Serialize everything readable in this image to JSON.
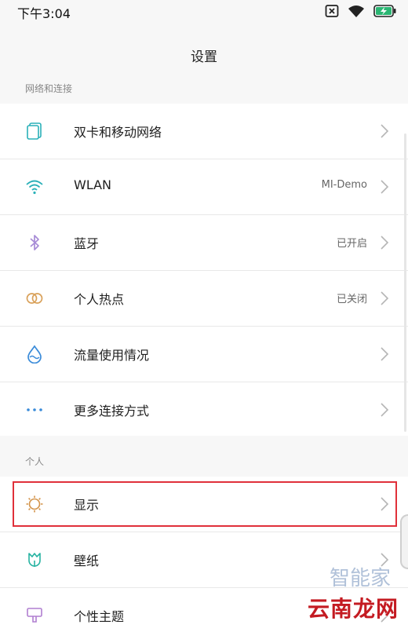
{
  "status_bar": {
    "time": "下午3:04",
    "icons": [
      "sim-none-icon",
      "wifi-icon",
      "battery-charging-icon"
    ]
  },
  "header": {
    "title": "设置"
  },
  "sections": {
    "network": {
      "title": "网络和连接",
      "items": [
        {
          "label": "双卡和移动网络",
          "value": "",
          "icon": "dual-sim-icon"
        },
        {
          "label": "WLAN",
          "value": "MI-Demo",
          "icon": "wifi-icon"
        },
        {
          "label": "蓝牙",
          "value": "已开启",
          "icon": "bluetooth-icon"
        },
        {
          "label": "个人热点",
          "value": "已关闭",
          "icon": "hotspot-icon"
        },
        {
          "label": "流量使用情况",
          "value": "",
          "icon": "data-usage-icon"
        },
        {
          "label": "更多连接方式",
          "value": "",
          "icon": "more-dots-icon"
        }
      ]
    },
    "personal": {
      "title": "个人",
      "items": [
        {
          "label": "显示",
          "value": "",
          "icon": "display-sun-icon"
        },
        {
          "label": "壁纸",
          "value": "",
          "icon": "wallpaper-tulip-icon"
        },
        {
          "label": "个性主题",
          "value": "",
          "icon": "theme-brush-icon"
        }
      ]
    }
  },
  "watermark": {
    "text": "云南龙网",
    "faint_text": "智能家"
  },
  "colors": {
    "accent_teal": "#2ab0b8",
    "bluetooth": "#a78bd6",
    "hotspot": "#d9a15a",
    "data_blue": "#3a8bd9",
    "highlight_red": "#e0303a",
    "display_orange": "#d3934a",
    "wallpaper_teal": "#27b3a2",
    "theme_purple": "#b07fd0"
  }
}
